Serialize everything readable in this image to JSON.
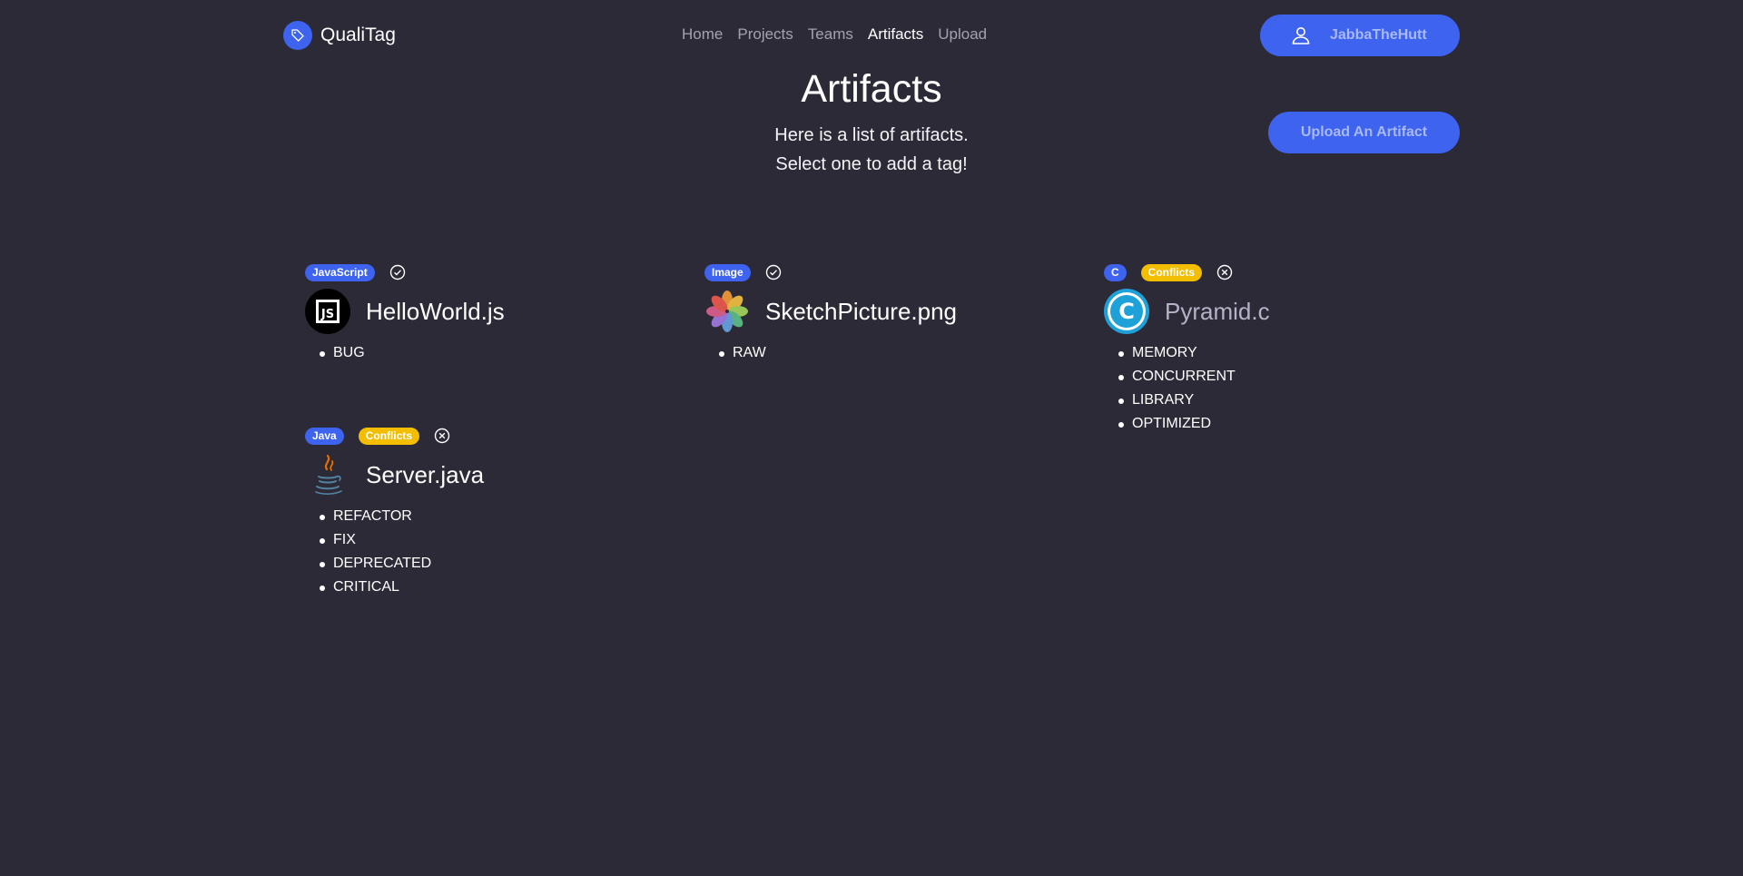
{
  "brand": {
    "name": "QualiTag",
    "icon": "tag-icon",
    "accent": "#3d63ef"
  },
  "nav": {
    "items": [
      {
        "label": "Home"
      },
      {
        "label": "Projects"
      },
      {
        "label": "Teams"
      },
      {
        "label": "Artifacts",
        "active": true
      },
      {
        "label": "Upload"
      }
    ]
  },
  "user": {
    "name": "JabbaTheHutt",
    "icon": "user-icon"
  },
  "page": {
    "title": "Artifacts",
    "subtitle_line1": "Here is a list of artifacts.",
    "subtitle_line2": "Select one to add a tag!",
    "upload_button": "Upload An Artifact"
  },
  "colors": {
    "background": "#2c2a37",
    "accent": "#3d63ef",
    "conflict": "#f3bd00"
  },
  "artifacts": [
    {
      "language": "JavaScript",
      "conflict_label": "",
      "status": "check-circle-icon",
      "file_icon": "javascript-icon",
      "name": "HelloWorld.js",
      "tags": [
        "BUG"
      ]
    },
    {
      "language": "Image",
      "conflict_label": "",
      "status": "check-circle-icon",
      "file_icon": "photos-icon",
      "name": "SketchPicture.png",
      "tags": [
        "RAW"
      ]
    },
    {
      "language": "C",
      "conflict_label": "Conflicts",
      "status": "x-circle-icon",
      "file_icon": "c-language-icon",
      "name": "Pyramid.c",
      "tags": [
        "MEMORY",
        "CONCURRENT",
        "LIBRARY",
        "OPTIMIZED"
      ]
    },
    {
      "language": "Java",
      "conflict_label": "Conflicts",
      "status": "x-circle-icon",
      "file_icon": "java-icon",
      "name": "Server.java",
      "tags": [
        "REFACTOR",
        "FIX",
        "DEPRECATED",
        "CRITICAL"
      ]
    }
  ]
}
